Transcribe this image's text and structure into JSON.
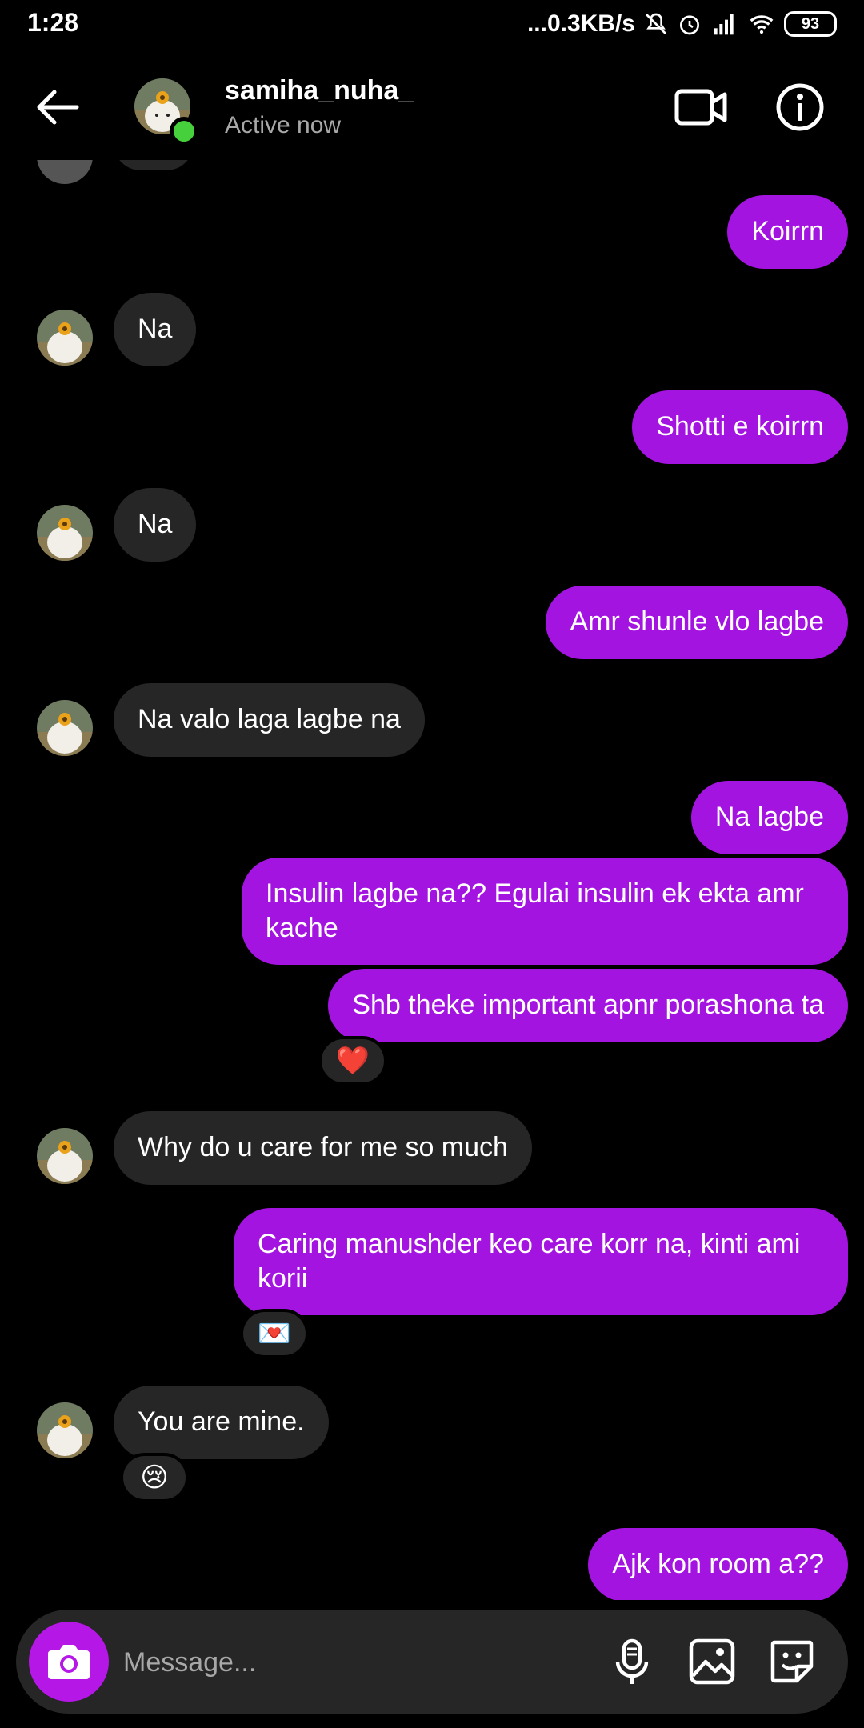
{
  "status_bar": {
    "time": "1:28",
    "network_speed": "...0.3KB/s",
    "battery": "93",
    "icons": [
      "mute-icon",
      "alarm-icon",
      "signal-icon",
      "wifi-icon",
      "battery-icon"
    ]
  },
  "header": {
    "username": "samiha_nuha_",
    "status": "Active now",
    "online_color": "#46d03b"
  },
  "messages": [
    {
      "from": "me",
      "text": "Koirrn"
    },
    {
      "from": "them",
      "text": "Na"
    },
    {
      "from": "me",
      "text": "Shotti e koirrn"
    },
    {
      "from": "them",
      "text": "Na"
    },
    {
      "from": "me",
      "text": "Amr shunle vlo lagbe"
    },
    {
      "from": "them",
      "text": "Na valo laga lagbe na"
    },
    {
      "from": "me",
      "text": "Na lagbe"
    },
    {
      "from": "me",
      "text": "Insulin lagbe na?? Egulai insulin ek ekta amr",
      "text2": "kache"
    },
    {
      "from": "me",
      "text": "Shb theke important apnr porashona ta",
      "reaction": "❤️"
    },
    {
      "from": "them",
      "text": "Why do u care for me so much"
    },
    {
      "from": "me",
      "text": "Caring manushder keo care korr na, kinti ami",
      "text2": "korii",
      "reaction": "💌"
    },
    {
      "from": "them",
      "text": "You are mine.",
      "reaction": "😢"
    },
    {
      "from": "me",
      "text": "Ajk kon room a??"
    }
  ],
  "composer": {
    "placeholder": "Message..."
  },
  "colors": {
    "sent_bubble": "#a414e0",
    "received_bubble": "#262626",
    "background": "#000000"
  }
}
